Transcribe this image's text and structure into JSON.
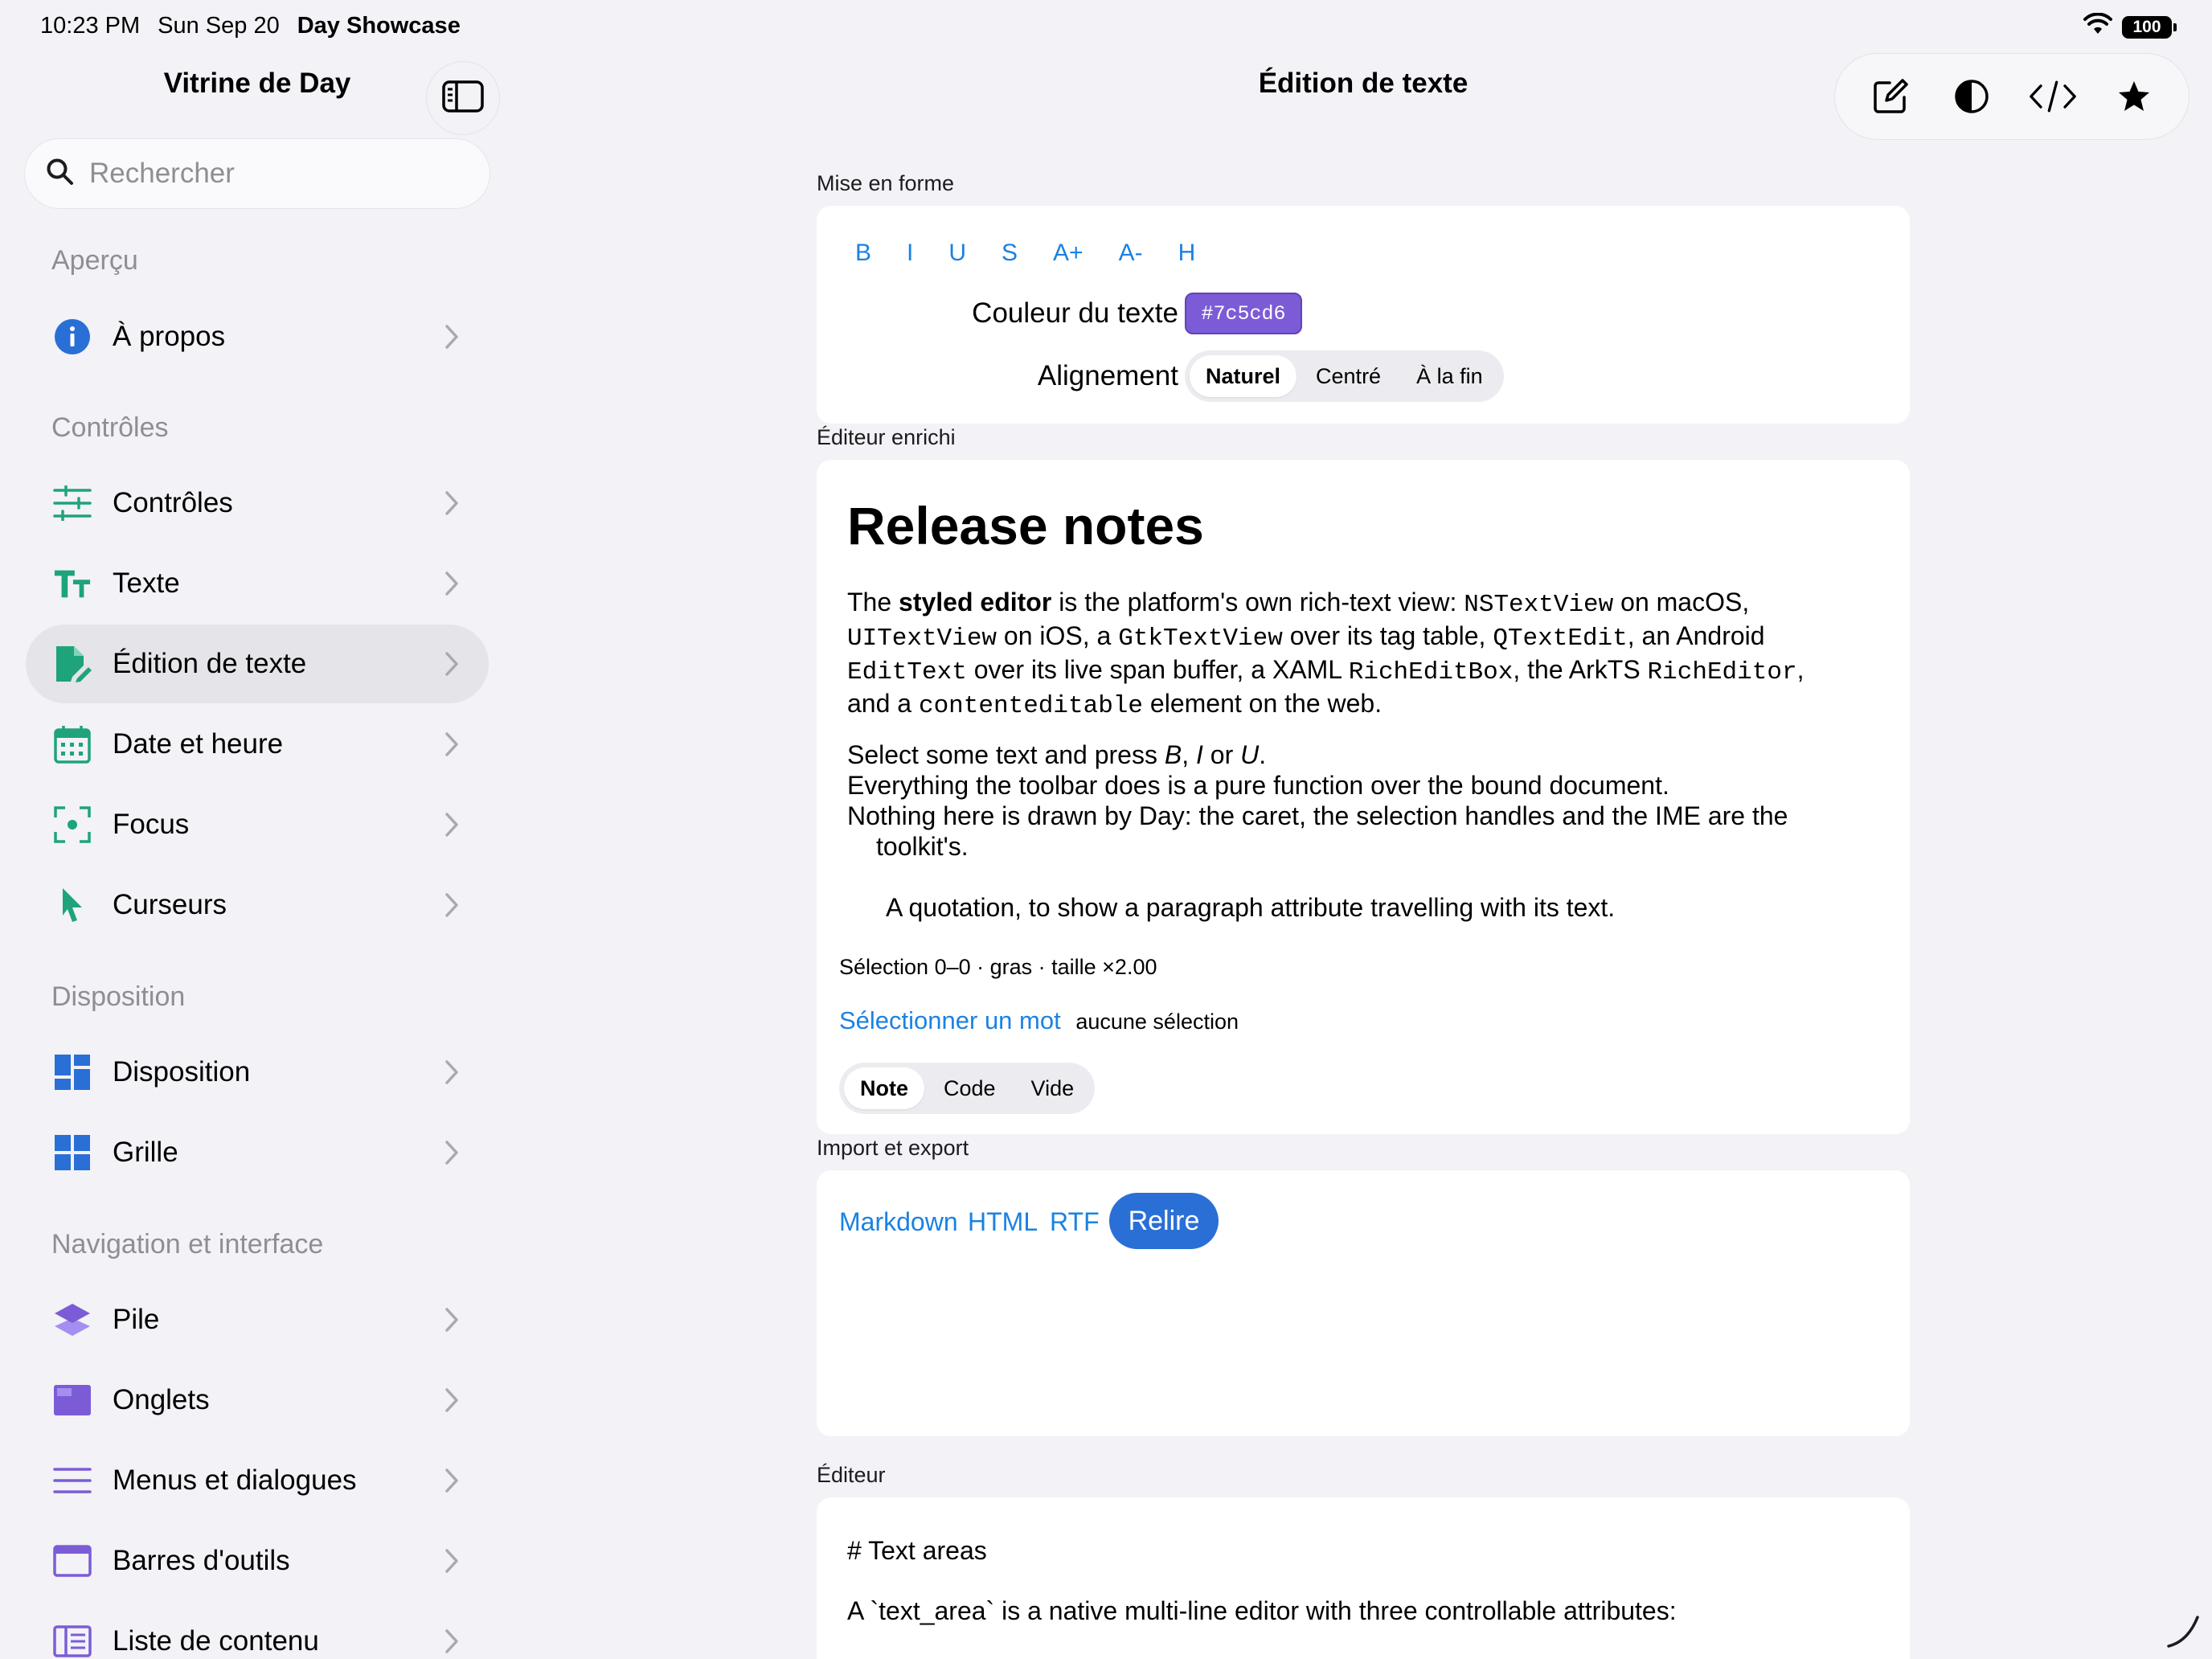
{
  "status_bar": {
    "time": "10:23 PM",
    "date": "Sun Sep 20",
    "app": "Day Showcase",
    "battery": "100"
  },
  "sidebar": {
    "title": "Vitrine de Day",
    "search_placeholder": "Rechercher",
    "sections": [
      {
        "header": "Aperçu",
        "items": [
          {
            "label": "À propos",
            "icon": "info-icon"
          }
        ]
      },
      {
        "header": "Contrôles",
        "items": [
          {
            "label": "Contrôles",
            "icon": "sliders-icon"
          },
          {
            "label": "Texte",
            "icon": "text-size-icon"
          },
          {
            "label": "Édition de texte",
            "icon": "document-edit-icon",
            "selected": true
          },
          {
            "label": "Date et heure",
            "icon": "calendar-icon"
          },
          {
            "label": "Focus",
            "icon": "focus-icon"
          },
          {
            "label": "Curseurs",
            "icon": "cursor-icon"
          }
        ]
      },
      {
        "header": "Disposition",
        "items": [
          {
            "label": "Disposition",
            "icon": "layout-icon"
          },
          {
            "label": "Grille",
            "icon": "grid-icon"
          }
        ]
      },
      {
        "header": "Navigation et interface",
        "items": [
          {
            "label": "Pile",
            "icon": "stack-icon"
          },
          {
            "label": "Onglets",
            "icon": "tabs-icon"
          },
          {
            "label": "Menus et dialogues",
            "icon": "menu-icon"
          },
          {
            "label": "Barres d'outils",
            "icon": "toolbar-icon"
          },
          {
            "label": "Liste de contenu",
            "icon": "list-icon"
          }
        ]
      }
    ]
  },
  "main": {
    "title": "Édition de texte",
    "toolbar_icons": [
      "compose-icon",
      "contrast-icon",
      "code-icon",
      "star-icon"
    ],
    "formatting": {
      "label": "Mise en forme",
      "buttons": [
        "B",
        "I",
        "U",
        "S",
        "A+",
        "A-",
        "H"
      ],
      "text_color_label": "Couleur du texte",
      "text_color_value": "#7c5cd6",
      "alignment_label": "Alignement",
      "alignment_options": [
        "Naturel",
        "Centré",
        "À la fin"
      ],
      "alignment_selected": "Naturel"
    },
    "rich_editor": {
      "label": "Éditeur enrichi",
      "heading": "Release notes",
      "p1": {
        "t1": "The ",
        "bold": "styled editor",
        "t2": " is the platform's own rich-text view: ",
        "m1": "NSTextView",
        "t3": " on macOS,",
        "m2": "UITextView",
        "t4": " on iOS, a ",
        "m3": "GtkTextView",
        "t5": " over its tag table, ",
        "m4": "QTextEdit",
        "t6": ", an Android",
        "m5": "EditText",
        "t7": " over its live span buffer, a XAML ",
        "m6": "RichEditBox",
        "t8": ", the ArkTS ",
        "m7": "RichEditor",
        "t9": ",",
        "t10": "and a ",
        "m8": "contenteditable",
        "t11": " element on the web."
      },
      "p2": {
        "t1": "Select some text and press ",
        "i1": "B",
        "t2": ", ",
        "i2": "I",
        "t3": " or ",
        "i3": "U",
        "t4": ".",
        "line2": "Everything the toolbar does is a pure function over the bound document.",
        "line3": "Nothing here is drawn by Day: the caret, the selection handles and the IME are the",
        "line4": "toolkit's."
      },
      "quote": "A quotation, to show a paragraph attribute travelling with its text.",
      "selection_status": "Sélection 0–0 · gras · taille ×2.00",
      "select_word": "Sélectionner un mot",
      "no_selection": "aucune sélection",
      "modes": [
        "Note",
        "Code",
        "Vide"
      ],
      "mode_selected": "Note"
    },
    "import_export": {
      "label": "Import et export",
      "links": [
        "Markdown",
        "HTML",
        "RTF"
      ],
      "button": "Relire"
    },
    "editor": {
      "label": "Éditeur",
      "line1": "# Text areas",
      "line2": "A `text_area` is a native multi-line editor with three controllable attributes:"
    }
  },
  "colors": {
    "accent": "#1a82e2",
    "button": "#2a6fd6",
    "sidebar_icon": "#1fa37a",
    "purple": "#7c5cd6",
    "blue_icon": "#2a6fd6"
  }
}
